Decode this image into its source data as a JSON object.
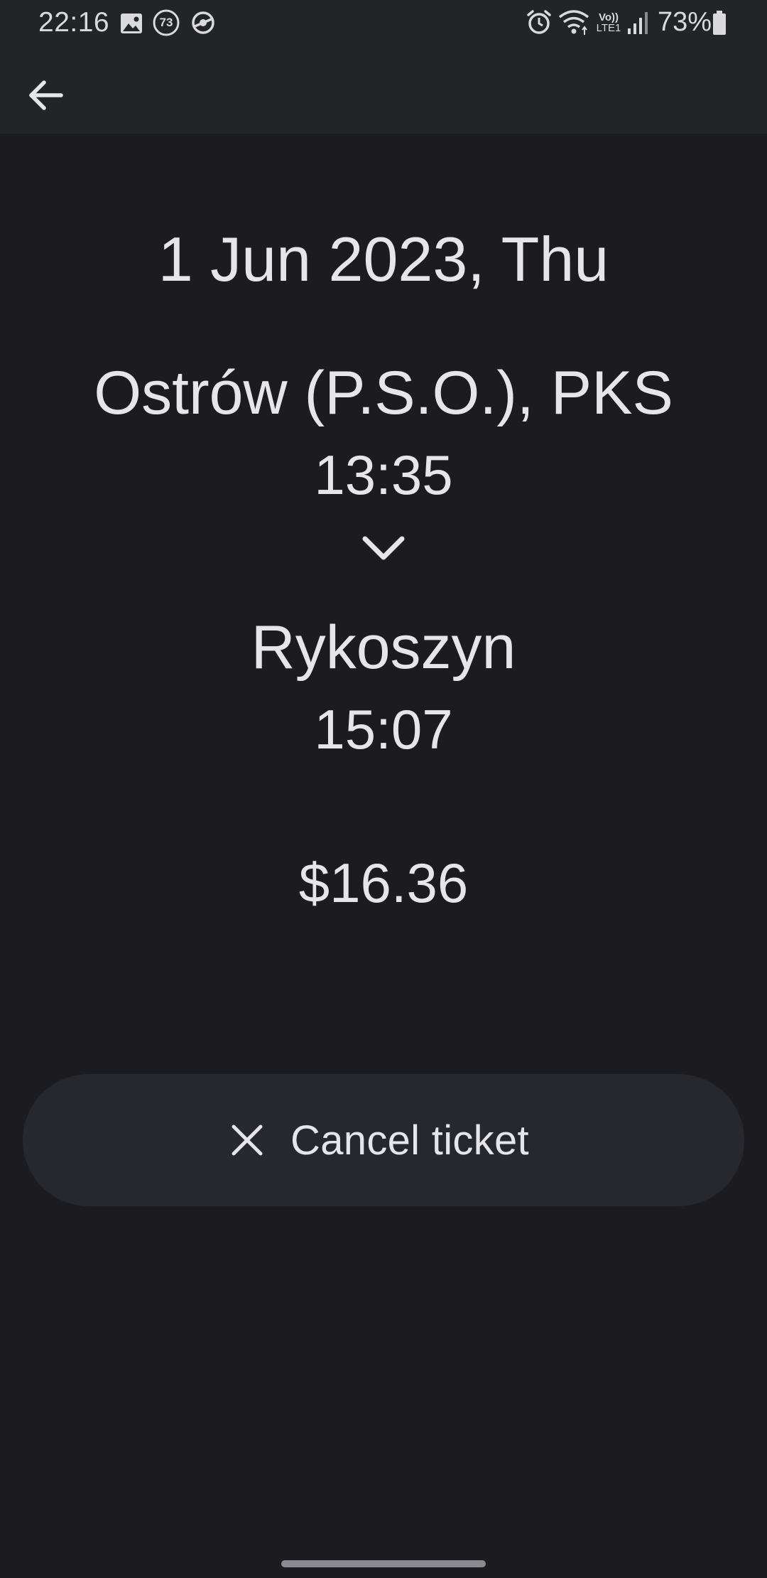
{
  "status_bar": {
    "time": "22:16",
    "notification_badge": "73",
    "network_label_top": "Vo))",
    "network_label_bottom": "LTE1",
    "battery_percent": "73%",
    "icons": [
      "gallery-icon",
      "badge-73-icon",
      "sync-icon",
      "alarm-icon",
      "wifi-icon",
      "volte-icon",
      "signal-icon",
      "battery-icon"
    ]
  },
  "app_bar": {
    "back_icon": "arrow-left-icon"
  },
  "ticket": {
    "date": "1 Jun 2023, Thu",
    "origin": {
      "name": "Ostrów (P.S.O.), PKS",
      "time": "13:35"
    },
    "direction_icon": "chevron-down-icon",
    "destination": {
      "name": "Rykoszyn",
      "time": "15:07"
    },
    "price": "$16.36"
  },
  "actions": {
    "cancel_label": "Cancel ticket",
    "cancel_icon": "close-icon"
  },
  "colors": {
    "background": "#1c1c20",
    "top_bar": "#232428",
    "button": "#27282d",
    "text": "#e6e6ea"
  }
}
